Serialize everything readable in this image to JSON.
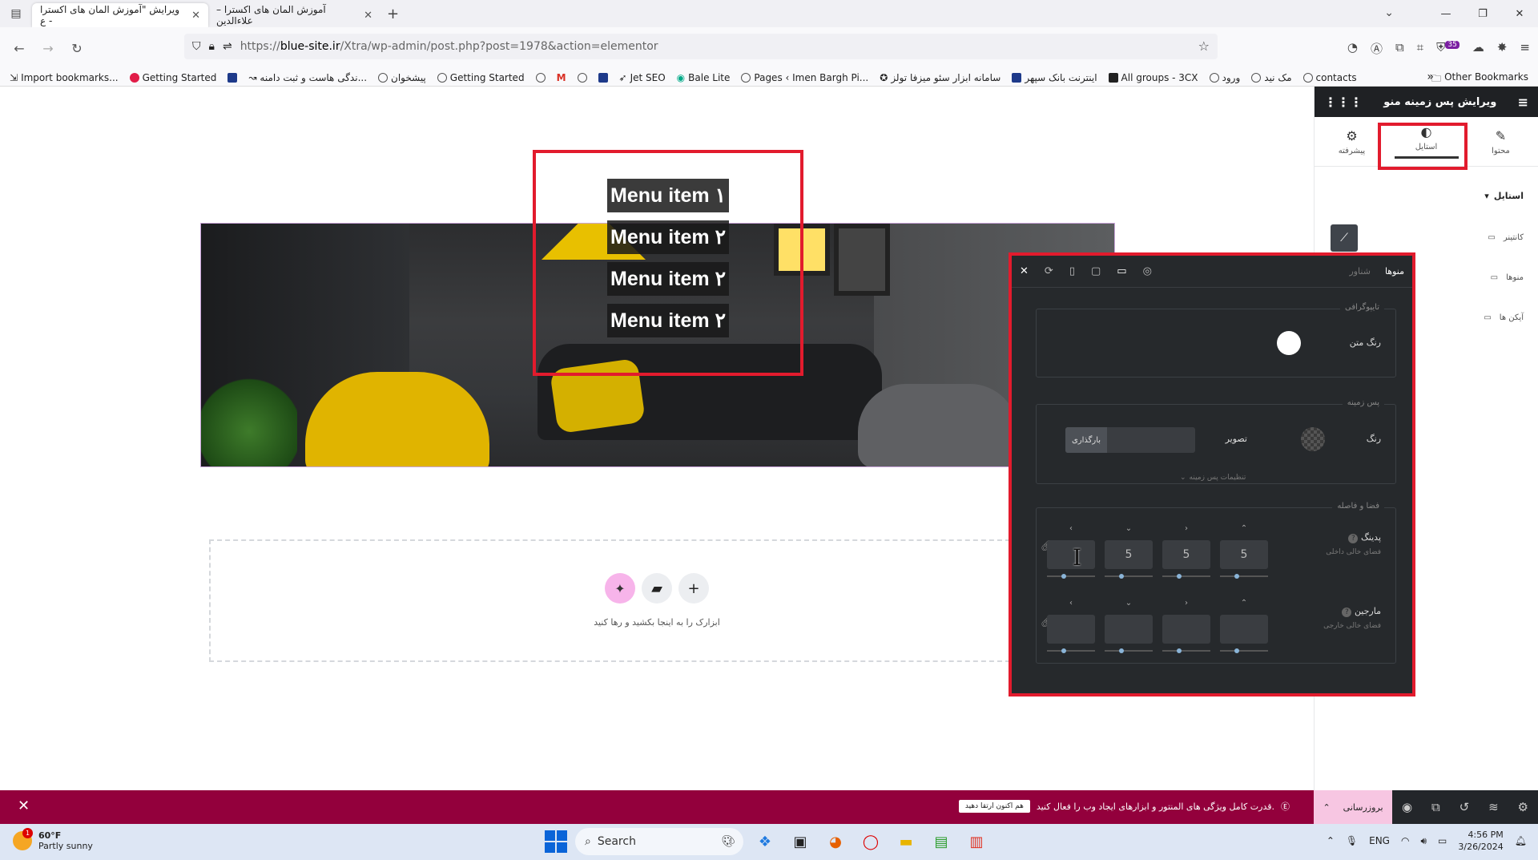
{
  "browser": {
    "tabs": [
      {
        "label": "ویرایش \"آموزش المان های اکسترا - ع",
        "active": true
      },
      {
        "label": "آموزش المان های اکسترا – علاءالدین",
        "active": false
      }
    ],
    "tab_close": "✕",
    "new_tab": "+",
    "url": {
      "prefix": "https://",
      "host": "blue-site.ir",
      "path": "/Xtra/wp-admin/post.php?post=1978&action=elementor"
    },
    "extension_badge": "35",
    "bookmarks": [
      "Import bookmarks...",
      "Getting Started",
      "ندگی هاست و ثبت دامنه...",
      "پیشخوان",
      "Getting Started",
      "Jet SEO",
      "Bale Lite",
      "Pages ‹ Imen Bargh Pi...",
      "سامانه ابزار سئو میزفا تولز",
      "اینترنت بانک سپهر",
      "All groups - 3CX",
      "ورود",
      "مک نید",
      "contacts"
    ],
    "other_bookmarks": "Other Bookmarks"
  },
  "canvas": {
    "menu_items": [
      "Menu item ۱",
      "Menu item ۲",
      "Menu item ۲",
      "Menu item ۲"
    ],
    "dropzone_text": "ابزارک را به اینجا بکشید و رها کنید"
  },
  "sidebar": {
    "title": "ویرایش پس زمینه منو",
    "tabs": [
      {
        "label": "محتوا",
        "icon": "pencil-icon"
      },
      {
        "label": "استایل",
        "icon": "contrast-icon"
      },
      {
        "label": "پیشرفته",
        "icon": "gear-icon"
      }
    ],
    "section": "استایل",
    "rows": [
      "کانتینر",
      "منوها",
      "آیکن ها"
    ]
  },
  "panel": {
    "tabs": {
      "normal": "منوها",
      "hover": "شناور"
    },
    "typography_legend": "تایپوگرافی",
    "text_color_label": "رنگ متن",
    "text_color": "#ffffff",
    "background_legend": "پس زمینه",
    "bg_color_label": "رنگ",
    "bg_image_label": "تصویر",
    "upload_label": "بارگذاری",
    "bg_settings": "تنظیمات پس زمینه",
    "spacing_legend": "فضا و فاصله",
    "padding_label": "پدینگ",
    "padding_sub": "فضای خالی داخلی",
    "padding_values": [
      "5",
      "5",
      "5",
      ""
    ],
    "margin_label": "مارجین",
    "margin_sub": "فضای خالی خارجی",
    "margin_values": [
      "",
      "",
      "",
      ""
    ]
  },
  "footer": {
    "promo_text": "قدرت کامل ویژگی های المنتور و ابزارهای ایجاد وب را فعال کنید.",
    "promo_button": "هم اکنون ارتقا دهید",
    "update_label": "بروزرسانی"
  },
  "taskbar": {
    "weather_temp": "60°F",
    "weather_desc": "Partly sunny",
    "weather_badge": "1",
    "search_label": "Search",
    "language": "ENG",
    "time": "4:56 PM",
    "date": "3/26/2024"
  },
  "colors": {
    "accent_red": "#e21b2d",
    "footer_bg": "#93003c",
    "panel_bg": "#26292c"
  }
}
